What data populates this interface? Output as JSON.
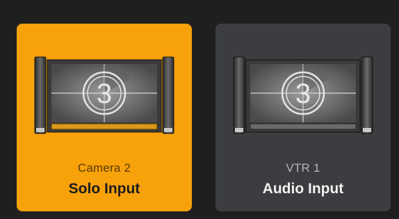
{
  "tiles": [
    {
      "source_label": "Camera 2",
      "mode_label": "Solo Input",
      "thumbnail_icon": "countdown-leader-monitor-icon",
      "countdown_digit": "3",
      "state": "selected",
      "background_color": "#f7a10b"
    },
    {
      "source_label": "VTR 1",
      "mode_label": "Audio Input",
      "thumbnail_icon": "countdown-leader-monitor-icon",
      "countdown_digit": "3",
      "state": "unselected",
      "background_color": "#3b3d40"
    }
  ]
}
